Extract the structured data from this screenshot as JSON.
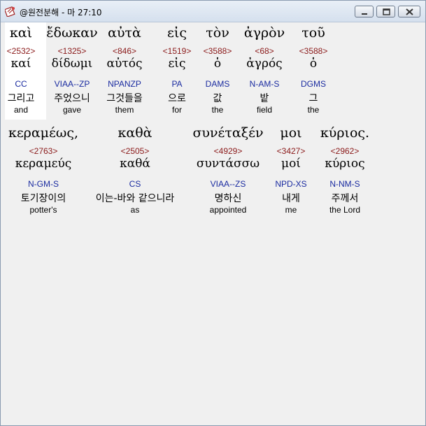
{
  "window": {
    "title": "@원전분해 - 마 27:10",
    "icon": "book-icon"
  },
  "accent_colors": {
    "strong": "#8b1a1a",
    "morph": "#1a2ba0",
    "title_bar": "#dce6f2"
  },
  "verse": {
    "line1": [
      {
        "greek": "καὶ",
        "strong": "<2532>",
        "lemma": "καί",
        "morph": "CC",
        "korean": "그리고",
        "english": "and"
      },
      {
        "greek": "ἔδωκαν",
        "strong": "<1325>",
        "lemma": "δίδωμι",
        "morph": "VIAA--ZP",
        "korean": "주었으니",
        "english": "gave"
      },
      {
        "greek": "αὐτὰ",
        "strong": "<846>",
        "lemma": "αὐτός",
        "morph": "NPANZP",
        "korean": "그것들을",
        "english": "them"
      },
      {
        "greek": "εἰς",
        "strong": "<1519>",
        "lemma": "εἰς",
        "morph": "PA",
        "korean": "으로",
        "english": "for"
      },
      {
        "greek": "τὸν",
        "strong": "<3588>",
        "lemma": "ὁ",
        "morph": "DAMS",
        "korean": "값",
        "english": "the"
      },
      {
        "greek": "ἀγρὸν",
        "strong": "<68>",
        "lemma": "ἀγρός",
        "morph": "N-AM-S",
        "korean": "밭",
        "english": "field"
      },
      {
        "greek": "τοῦ",
        "strong": "<3588>",
        "lemma": "ὁ",
        "morph": "DGMS",
        "korean": "그",
        "english": "the"
      }
    ],
    "line2": [
      {
        "greek": "κεραμέως,",
        "strong": "<2763>",
        "lemma": "κεραμεύς",
        "morph": "N-GM-S",
        "korean": "토기장이의",
        "english": "potter's"
      },
      {
        "greek": "καθὰ",
        "strong": "<2505>",
        "lemma": "καθά",
        "morph": "CS",
        "korean": "이는-바와 같으니라",
        "english": "as"
      },
      {
        "greek": "συνέταξέν",
        "strong": "<4929>",
        "lemma": "συντάσσω",
        "morph": "VIAA--ZS",
        "korean": "명하신",
        "english": "appointed"
      },
      {
        "greek": "μοι",
        "strong": "<3427>",
        "lemma": "μοί",
        "morph": "NPD-XS",
        "korean": "내게",
        "english": "me"
      },
      {
        "greek": "κύριος.",
        "strong": "<2962>",
        "lemma": "κύριος",
        "morph": "N-NM-S",
        "korean": "주께서",
        "english": "the Lord"
      }
    ]
  }
}
